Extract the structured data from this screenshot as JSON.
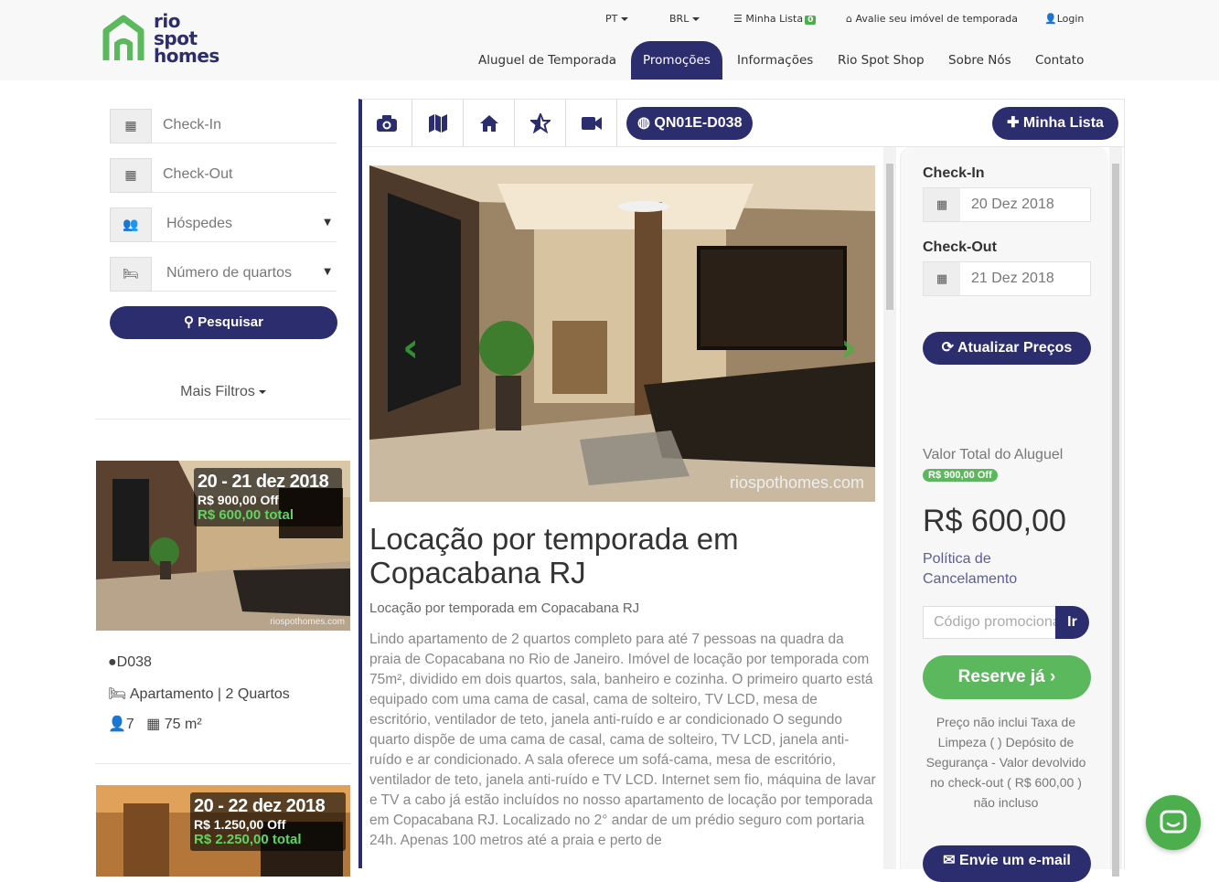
{
  "logo": {
    "line1": "rio",
    "line2": "spot",
    "line3": "homes"
  },
  "topbar": {
    "language": "PT",
    "currency": "BRL",
    "my_list": "Minha Lista",
    "my_list_count": "0",
    "evaluate": "Avalie seu imóvel de temporada",
    "login": "Login"
  },
  "nav": {
    "items": [
      "Aluguel de Temporada",
      "Promoções",
      "Informações",
      "Rio Spot Shop",
      "Sobre Nós",
      "Contato"
    ],
    "active": "Promoções"
  },
  "search": {
    "checkin_placeholder": "Check-In",
    "checkout_placeholder": "Check-Out",
    "guests": "Hóspedes",
    "rooms": "Número de quartos",
    "button": "Pesquisar",
    "more_filters": "Mais Filtros"
  },
  "cards": [
    {
      "dates": "20 - 21 dez 2018",
      "discount": "R$ 900,00 Off",
      "total": "R$ 600,00 total",
      "watermark": "riospothomes.com",
      "code": "D038",
      "type": "Apartamento | 2 Quartos",
      "guests": "7",
      "area": "75 m²"
    },
    {
      "dates": "20 - 22 dez 2018",
      "discount": "R$ 1.250,00 Off",
      "total": "R$ 2.250,00 total"
    }
  ],
  "listing": {
    "code": "QN01E-D038",
    "my_list_button": "Minha Lista",
    "watermark": "riospothomes.com",
    "title": "Locação por temporada em Copacabana RJ",
    "subtitle": "Locação por temporada em Copacabana RJ",
    "description": "Lindo apartamento de 2 quartos completo para até 7 pessoas na quadra da praia de Copacabana no Rio de Janeiro. Imóvel de locação por temporada com 75m², dividido em dois quartos, sala, banheiro e cozinha. O primeiro quarto está equipado com uma cama de casal, cama de solteiro, TV LCD, mesa de escritório, ventilador de teto, janela anti-ruído e ar condicionado O segundo quarto dispõe de uma cama de casal, cama de solteiro, TV LCD, janela anti-ruído e ar condicionado. A sala oferece um sofá-cama, mesa de escritório, ventilador de teto, janela anti-ruído e TV LCD. Internet sem fio, máquina de lavar e TV a cabo já estão incluídos no nosso apartamento de locação por temporada em Copacabana RJ. Localizado no 2° andar de um prédio seguro com portaria 24h. Apenas 100 metros até a praia e perto de"
  },
  "booking": {
    "checkin_label": "Check-In",
    "checkin_value": "20 Dez 2018",
    "checkout_label": "Check-Out",
    "checkout_value": "21 Dez 2018",
    "update_button": "Atualizar Preços",
    "total_label": "Valor Total do Aluguel",
    "off_badge": "R$ 900,00 Off",
    "price": "R$ 600,00",
    "policy": "Política de Cancelamento",
    "promo_placeholder": "Código promocional",
    "promo_button": "Ir",
    "reserve_button": "Reserve já",
    "note": "Preço não inclui Taxa de Limpeza ( ) Depósito de Segurança - Valor devolvido no check-out ( R$ 600,00 ) não incluso",
    "email_button": "Envie um e-mail"
  },
  "colors": {
    "brand_navy": "#2b2d6e",
    "brand_green": "#5cb85c"
  }
}
